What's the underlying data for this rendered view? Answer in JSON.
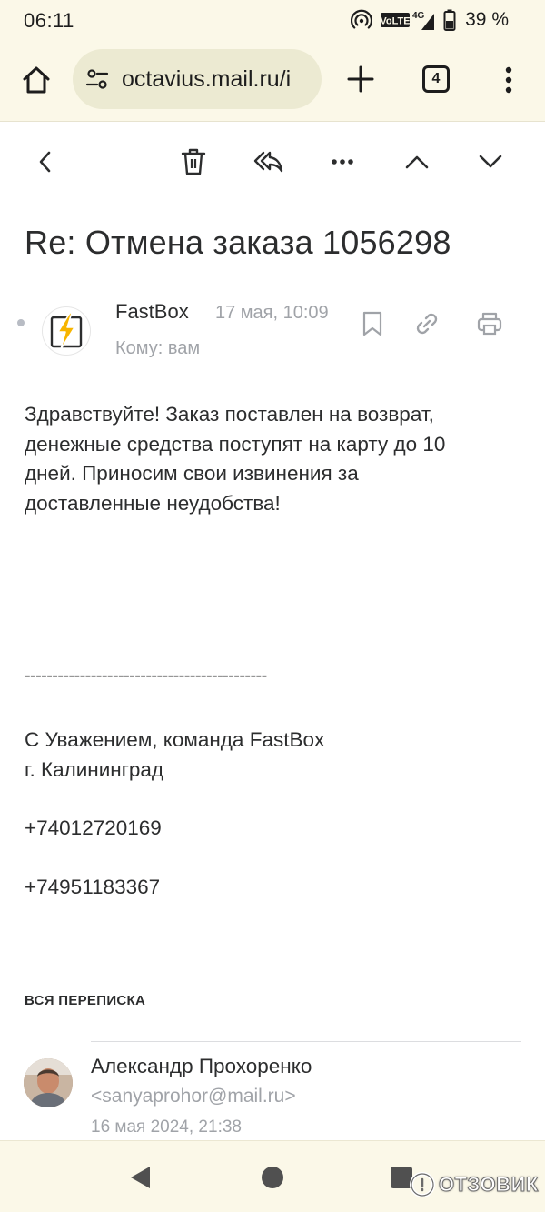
{
  "status_bar": {
    "time": "06:11",
    "network_label": "VoLTE",
    "network_type": "4G",
    "battery": "39 %",
    "icons": [
      "hotspot-icon",
      "volte-icon",
      "signal-icon",
      "battery-icon"
    ]
  },
  "browser": {
    "url": "octavius.mail.ru/i",
    "tab_count": "4",
    "icons": [
      "home-icon",
      "site-settings-icon",
      "new-tab-icon",
      "tab-switcher-icon",
      "overflow-menu-icon"
    ]
  },
  "toolbar": {
    "icons": [
      "back-icon",
      "trash-icon",
      "reply-all-icon",
      "more-icon",
      "chevron-up-icon",
      "chevron-down-icon"
    ]
  },
  "message": {
    "subject": "Re: Отмена заказа 1056298",
    "sender": "FastBox",
    "date": "17 мая, 10:09",
    "recipient": "Кому: вам",
    "body_lines": [
      "Здравствуйте! Заказ поставлен на возврат,",
      "денежные средства поступят на карту до 10",
      "дней. Приносим свои извинения за",
      "доставленные неудобства!"
    ],
    "separator": "--------------------------------------------",
    "signature_lines": [
      "С Уважением, команда FastBox",
      "г. Калининград"
    ],
    "phones": [
      "+74012720169",
      "+74951183367"
    ]
  },
  "thread": {
    "heading": "ВСЯ ПЕРЕПИСКА",
    "items": [
      {
        "name": "Александр Прохоренко",
        "email": "<sanyaprohor@mail.ru>",
        "date": "16 мая 2024, 21:38"
      }
    ]
  },
  "watermark": "ОТЗОВИК",
  "colors": {
    "chrome_bg": "#fbf8e8",
    "url_pill_bg": "#ecead2",
    "text_primary": "#2c2d2e",
    "text_secondary": "#a0a3a8",
    "avatar_bolt": "#f7b500"
  }
}
